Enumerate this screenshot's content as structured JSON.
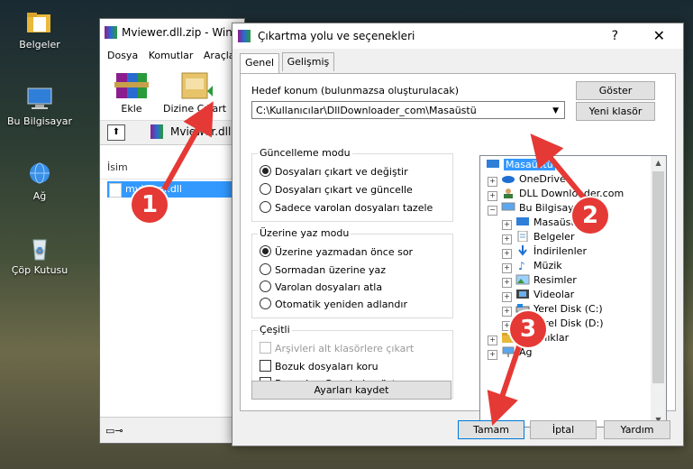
{
  "desktop": {
    "icons": [
      {
        "label": "Belgeler",
        "icon": "folder-icon"
      },
      {
        "label": "Bu Bilgisayar",
        "icon": "computer-icon"
      },
      {
        "label": "Ağ",
        "icon": "network-icon"
      },
      {
        "label": "Çöp Kutusu",
        "icon": "recycle-bin-icon"
      }
    ]
  },
  "winrar": {
    "title": "Mviewer.dll.zip - Win",
    "menu": [
      "Dosya",
      "Komutlar",
      "Araçla"
    ],
    "toolbar": {
      "add_label": "Ekle",
      "extract_label": "Dizine Çıkart"
    },
    "address": "Mviewer.dll",
    "column_name": "İsim",
    "file_name": "mviewer.dll"
  },
  "dialog": {
    "title": "Çıkartma yolu ve seçenekleri",
    "help_glyph": "?",
    "close_glyph": "✕",
    "tabs": [
      "Genel",
      "Gelişmiş"
    ],
    "target_label": "Hedef konum (bulunmazsa oluşturulacak)",
    "target_path": "C:\\Kullanıcılar\\DllDownloader_com\\Masaüstü",
    "show_button": "Göster",
    "new_folder_button": "Yeni klasör",
    "update_mode": {
      "title": "Güncelleme modu",
      "options": [
        "Dosyaları çıkart ve değiştir",
        "Dosyaları çıkart ve güncelle",
        "Sadece varolan dosyaları tazele"
      ],
      "selected": 0
    },
    "overwrite_mode": {
      "title": "Üzerine yaz modu",
      "options": [
        "Üzerine yazmadan önce sor",
        "Sormadan üzerine yaz",
        "Varolan dosyaları atla",
        "Otomatik yeniden adlandır"
      ],
      "selected": 0
    },
    "misc": {
      "title": "Çeşitli",
      "options": [
        "Arşivleri alt klasörlere çıkart",
        "Bozuk dosyaları koru",
        "Dosyaları Gezginde göster"
      ],
      "disabled_first": true
    },
    "save_settings_button": "Ayarları kaydet",
    "tree": [
      {
        "label": "Masaüstü",
        "icon": "desktop-icon",
        "level": 0,
        "expander": "",
        "selected": true
      },
      {
        "label": "OneDrive",
        "icon": "cloud-icon",
        "level": 1,
        "expander": "+"
      },
      {
        "label": "DLL Downloader.com",
        "icon": "user-icon",
        "level": 1,
        "expander": "+"
      },
      {
        "label": "Bu Bilgisayar",
        "icon": "computer-icon",
        "level": 1,
        "expander": "−"
      },
      {
        "label": "Masaüstü",
        "icon": "desktop-icon",
        "level": 2,
        "expander": "+"
      },
      {
        "label": "Belgeler",
        "icon": "documents-icon",
        "level": 2,
        "expander": "+"
      },
      {
        "label": "İndirilenler",
        "icon": "download-icon",
        "level": 2,
        "expander": "+"
      },
      {
        "label": "Müzik",
        "icon": "music-icon",
        "level": 2,
        "expander": "+"
      },
      {
        "label": "Resimler",
        "icon": "pictures-icon",
        "level": 2,
        "expander": "+"
      },
      {
        "label": "Videolar",
        "icon": "videos-icon",
        "level": 2,
        "expander": "+"
      },
      {
        "label": "Yerel Disk (C:)",
        "icon": "drive-icon",
        "level": 2,
        "expander": "+"
      },
      {
        "label": "Yerel Disk (D:)",
        "icon": "drive-icon",
        "level": 2,
        "expander": "+"
      },
      {
        "label": "Kitaplıklar",
        "icon": "library-icon",
        "level": 1,
        "expander": "+"
      },
      {
        "label": "Ağ",
        "icon": "network-icon",
        "level": 1,
        "expander": "+"
      }
    ],
    "ok_button": "Tamam",
    "cancel_button": "İptal",
    "help_button": "Yardım"
  },
  "markers": [
    "1",
    "2",
    "3"
  ],
  "colors": {
    "marker": "#e53935",
    "selection": "#3399ff"
  }
}
